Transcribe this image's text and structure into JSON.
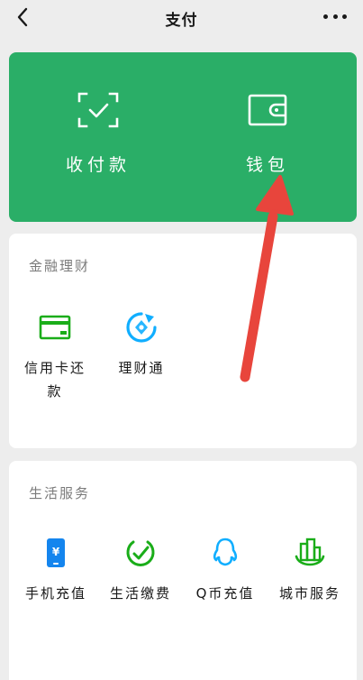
{
  "nav": {
    "title": "支付",
    "back_icon": "chevron-left-icon",
    "more_icon": "more-dots-icon"
  },
  "green_card": {
    "bg_color": "#2aae67",
    "items": [
      {
        "label": "收付款",
        "icon": "scan-frame-icon"
      },
      {
        "label": "钱包",
        "icon": "wallet-icon"
      }
    ]
  },
  "finance": {
    "title": "金融理财",
    "items": [
      {
        "label": "信用卡还款",
        "icon": "credit-card-icon"
      },
      {
        "label": "理财通",
        "icon": "wealth-icon"
      }
    ]
  },
  "life": {
    "title": "生活服务",
    "items": [
      {
        "label": "手机充值",
        "icon": "phone-topup-icon"
      },
      {
        "label": "生活缴费",
        "icon": "utility-bill-icon"
      },
      {
        "label": "Q币充值",
        "icon": "qq-coin-icon"
      },
      {
        "label": "城市服务",
        "icon": "city-service-icon"
      }
    ]
  },
  "annotation": {
    "arrow_color": "#e8453c"
  }
}
